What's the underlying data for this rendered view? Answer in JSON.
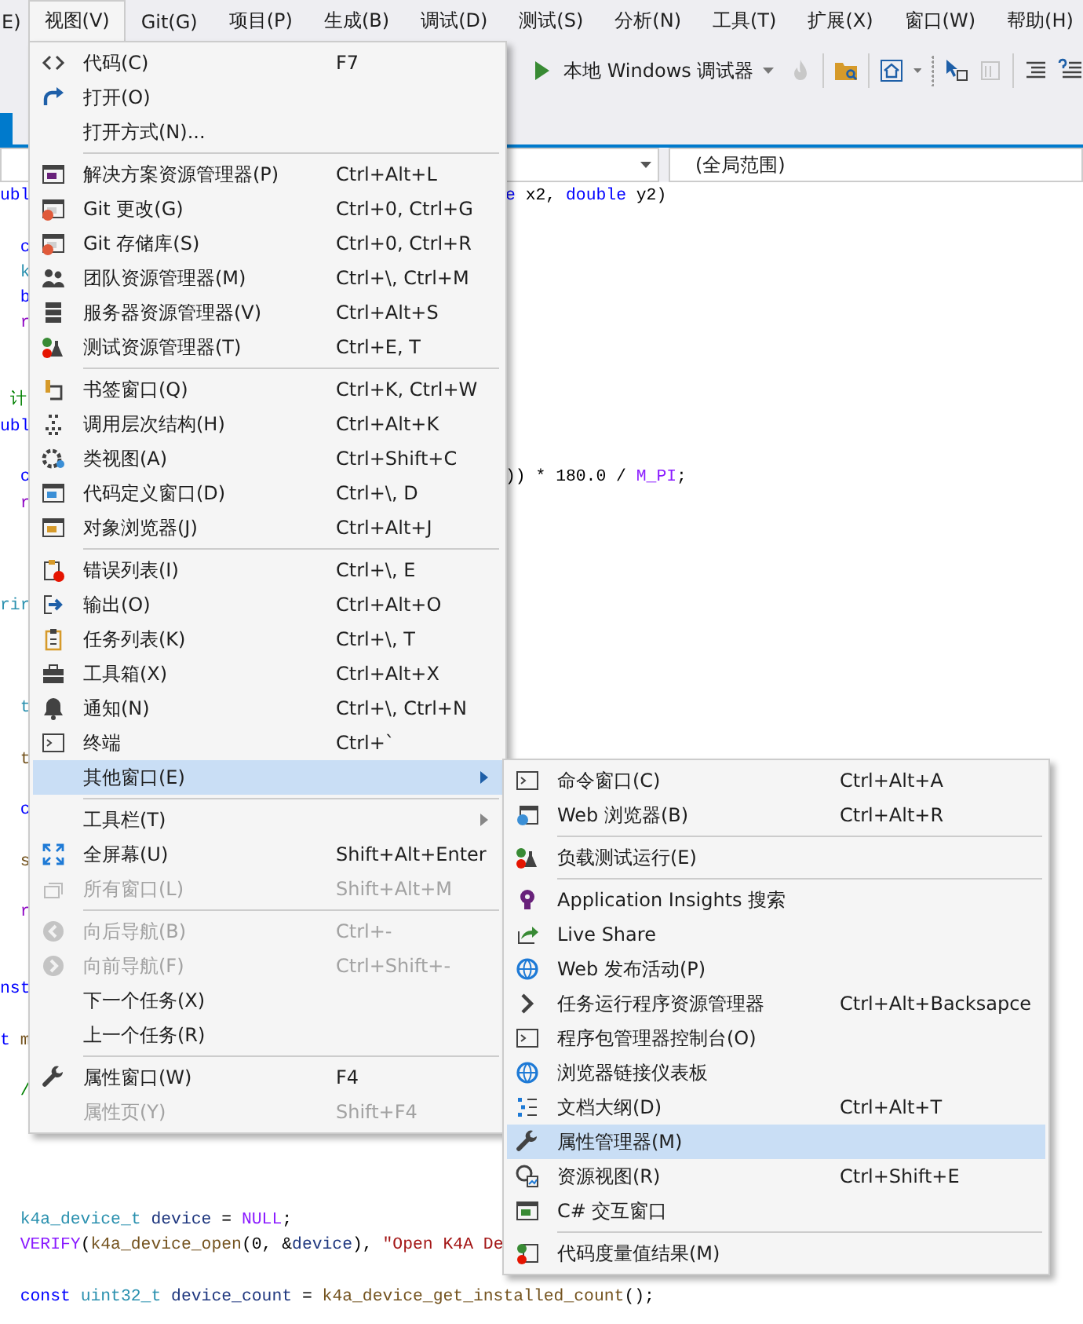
{
  "menu_bar": [
    {
      "label": "E)",
      "selected": false
    },
    {
      "label": "视图(V)",
      "selected": true
    },
    {
      "label": "Git(G)",
      "selected": false
    },
    {
      "label": "项目(P)",
      "selected": false
    },
    {
      "label": "生成(B)",
      "selected": false
    },
    {
      "label": "调试(D)",
      "selected": false
    },
    {
      "label": "测试(S)",
      "selected": false
    },
    {
      "label": "分析(N)",
      "selected": false
    },
    {
      "label": "工具(T)",
      "selected": false
    },
    {
      "label": "扩展(X)",
      "selected": false
    },
    {
      "label": "窗口(W)",
      "selected": false
    },
    {
      "label": "帮助(H)",
      "selected": false
    }
  ],
  "toolbar": {
    "debug_target": "本地 Windows 调试器"
  },
  "nav_bar": {
    "scope": "(全局范围)"
  },
  "code_lines": [
    {
      "tokens": [
        {
          "text": "ubl",
          "kind": "keyword"
        }
      ],
      "after_menu": [
        {
          "text": "e",
          "kind": "keyword"
        },
        {
          "text": " x2, ",
          "kind": "plain"
        },
        {
          "text": "double",
          "kind": "keyword"
        },
        {
          "text": " y2)",
          "kind": "plain"
        }
      ]
    },
    {
      "tokens": [
        {
          "text": "  c",
          "kind": "keyword"
        }
      ]
    },
    {
      "tokens": [
        {
          "text": "  k",
          "kind": "type"
        }
      ]
    },
    {
      "tokens": [
        {
          "text": "  b",
          "kind": "keyword"
        }
      ]
    },
    {
      "tokens": [
        {
          "text": "  r",
          "kind": "control"
        }
      ]
    },
    {
      "tokens": [
        {
          "text": " 计",
          "kind": "comment"
        }
      ]
    },
    {
      "tokens": [
        {
          "text": "ubl",
          "kind": "keyword"
        }
      ]
    },
    {
      "tokens": [
        {
          "text": "  c",
          "kind": "keyword"
        }
      ],
      "after_menu": [
        {
          "text": ")) * 180.0 / ",
          "kind": "plain"
        },
        {
          "text": "M_PI",
          "kind": "macro"
        },
        {
          "text": ";",
          "kind": "plain"
        }
      ]
    },
    {
      "tokens": [
        {
          "text": "  r",
          "kind": "control"
        }
      ]
    },
    {
      "tokens": [
        {
          "text": "rir",
          "kind": "type"
        }
      ]
    },
    {
      "tokens": [
        {
          "text": "  t",
          "kind": "type"
        }
      ]
    },
    {
      "tokens": [
        {
          "text": "  t",
          "kind": "function"
        }
      ]
    },
    {
      "tokens": [
        {
          "text": "  c",
          "kind": "keyword"
        }
      ]
    },
    {
      "tokens": [
        {
          "text": "  s",
          "kind": "function"
        }
      ]
    },
    {
      "tokens": [
        {
          "text": "  r",
          "kind": "control"
        }
      ]
    },
    {
      "tokens": [
        {
          "text": "nst",
          "kind": "keyword"
        }
      ]
    },
    {
      "tokens": [
        {
          "text": "t",
          "kind": "keyword"
        },
        {
          "text": " m",
          "kind": "function"
        }
      ]
    },
    {
      "tokens": [
        {
          "text": "  /",
          "kind": "comment"
        }
      ]
    },
    {
      "tokens": [
        {
          "text": "  k4a_device_t",
          "kind": "type"
        },
        {
          "text": " device",
          "kind": "variable"
        },
        {
          "text": " = ",
          "kind": "plain"
        },
        {
          "text": "NULL",
          "kind": "macro"
        },
        {
          "text": ";",
          "kind": "plain"
        }
      ]
    },
    {
      "tokens": [
        {
          "text": "  VERIFY",
          "kind": "macro"
        },
        {
          "text": "(",
          "kind": "plain"
        },
        {
          "text": "k4a_device_open",
          "kind": "function"
        },
        {
          "text": "(0, &",
          "kind": "plain"
        },
        {
          "text": "device",
          "kind": "variable"
        },
        {
          "text": "), ",
          "kind": "plain"
        },
        {
          "text": "\"Open K4A De",
          "kind": "string"
        }
      ]
    },
    {
      "tokens": [
        {
          "text": "  const",
          "kind": "keyword"
        },
        {
          "text": " uint32_t",
          "kind": "type"
        },
        {
          "text": " device_count",
          "kind": "variable"
        },
        {
          "text": " = ",
          "kind": "plain"
        },
        {
          "text": "k4a_device_get_installed_count",
          "kind": "function"
        },
        {
          "text": "();",
          "kind": "plain"
        }
      ]
    }
  ],
  "view_menu": {
    "groups": [
      {
        "items": [
          {
            "label": "代码(C)",
            "shortcut": "F7",
            "disabled": false,
            "selected": false,
            "has_submenu": false
          },
          {
            "label": "打开(O)",
            "disabled": false,
            "selected": false,
            "has_submenu": false
          },
          {
            "label": "打开方式(N)...",
            "disabled": false,
            "selected": false,
            "has_submenu": false
          }
        ]
      },
      {
        "items": [
          {
            "label": "解决方案资源管理器(P)",
            "shortcut": "Ctrl+Alt+L",
            "disabled": false,
            "selected": false,
            "has_submenu": false
          },
          {
            "label": "Git 更改(G)",
            "shortcut": "Ctrl+0, Ctrl+G",
            "disabled": false,
            "selected": false,
            "has_submenu": false
          },
          {
            "label": "Git 存储库(S)",
            "shortcut": "Ctrl+0, Ctrl+R",
            "disabled": false,
            "selected": false,
            "has_submenu": false
          },
          {
            "label": "团队资源管理器(M)",
            "shortcut": "Ctrl+\\, Ctrl+M",
            "disabled": false,
            "selected": false,
            "has_submenu": false
          },
          {
            "label": "服务器资源管理器(V)",
            "shortcut": "Ctrl+Alt+S",
            "disabled": false,
            "selected": false,
            "has_submenu": false
          },
          {
            "label": "测试资源管理器(T)",
            "shortcut": "Ctrl+E, T",
            "disabled": false,
            "selected": false,
            "has_submenu": false
          }
        ]
      },
      {
        "items": [
          {
            "label": "书签窗口(Q)",
            "shortcut": "Ctrl+K, Ctrl+W",
            "disabled": false,
            "selected": false,
            "has_submenu": false
          },
          {
            "label": "调用层次结构(H)",
            "shortcut": "Ctrl+Alt+K",
            "disabled": false,
            "selected": false,
            "has_submenu": false
          },
          {
            "label": "类视图(A)",
            "shortcut": "Ctrl+Shift+C",
            "disabled": false,
            "selected": false,
            "has_submenu": false
          },
          {
            "label": "代码定义窗口(D)",
            "shortcut": "Ctrl+\\, D",
            "disabled": false,
            "selected": false,
            "has_submenu": false
          },
          {
            "label": "对象浏览器(J)",
            "shortcut": "Ctrl+Alt+J",
            "disabled": false,
            "selected": false,
            "has_submenu": false
          }
        ]
      },
      {
        "items": [
          {
            "label": "错误列表(I)",
            "shortcut": "Ctrl+\\, E",
            "disabled": false,
            "selected": false,
            "has_submenu": false
          },
          {
            "label": "输出(O)",
            "shortcut": "Ctrl+Alt+O",
            "disabled": false,
            "selected": false,
            "has_submenu": false
          },
          {
            "label": "任务列表(K)",
            "shortcut": "Ctrl+\\, T",
            "disabled": false,
            "selected": false,
            "has_submenu": false
          },
          {
            "label": "工具箱(X)",
            "shortcut": "Ctrl+Alt+X",
            "disabled": false,
            "selected": false,
            "has_submenu": false
          },
          {
            "label": "通知(N)",
            "shortcut": "Ctrl+\\, Ctrl+N",
            "disabled": false,
            "selected": false,
            "has_submenu": false
          },
          {
            "label": "终端",
            "shortcut": "Ctrl+`",
            "disabled": false,
            "selected": false,
            "has_submenu": false
          },
          {
            "label": "其他窗口(E)",
            "disabled": false,
            "selected": true,
            "has_submenu": true
          }
        ]
      },
      {
        "items": [
          {
            "label": "工具栏(T)",
            "disabled": false,
            "selected": false,
            "has_submenu": true
          },
          {
            "label": "全屏幕(U)",
            "shortcut": "Shift+Alt+Enter",
            "disabled": false,
            "selected": false,
            "has_submenu": false
          },
          {
            "label": "所有窗口(L)",
            "shortcut": "Shift+Alt+M",
            "disabled": true,
            "selected": false,
            "has_submenu": false
          }
        ]
      },
      {
        "items": [
          {
            "label": "向后导航(B)",
            "shortcut": "Ctrl+-",
            "disabled": true,
            "selected": false,
            "has_submenu": false
          },
          {
            "label": "向前导航(F)",
            "shortcut": "Ctrl+Shift+-",
            "disabled": true,
            "selected": false,
            "has_submenu": false
          },
          {
            "label": "下一个任务(X)",
            "disabled": false,
            "selected": false,
            "has_submenu": false
          },
          {
            "label": "上一个任务(R)",
            "disabled": false,
            "selected": false,
            "has_submenu": false
          }
        ]
      },
      {
        "items": [
          {
            "label": "属性窗口(W)",
            "shortcut": "F4",
            "disabled": false,
            "selected": false,
            "has_submenu": false
          },
          {
            "label": "属性页(Y)",
            "shortcut": "Shift+F4",
            "disabled": true,
            "selected": false,
            "has_submenu": false
          }
        ]
      }
    ]
  },
  "other_windows_menu": {
    "groups": [
      {
        "items": [
          {
            "label": "命令窗口(C)",
            "shortcut": "Ctrl+Alt+A",
            "selected": false
          },
          {
            "label": "Web 浏览器(B)",
            "shortcut": "Ctrl+Alt+R",
            "selected": false
          }
        ]
      },
      {
        "items": [
          {
            "label": "负载测试运行(E)",
            "selected": false
          }
        ]
      },
      {
        "items": [
          {
            "label": "Application Insights 搜索",
            "selected": false
          },
          {
            "label": "Live Share",
            "selected": false
          },
          {
            "label": "Web 发布活动(P)",
            "selected": false
          },
          {
            "label": "任务运行程序资源管理器",
            "shortcut": "Ctrl+Alt+Backsapce",
            "selected": false
          },
          {
            "label": "程序包管理器控制台(O)",
            "selected": false
          },
          {
            "label": "浏览器链接仪表板",
            "selected": false
          },
          {
            "label": "文档大纲(D)",
            "shortcut": "Ctrl+Alt+T",
            "selected": false
          },
          {
            "label": "属性管理器(M)",
            "selected": true
          },
          {
            "label": "资源视图(R)",
            "shortcut": "Ctrl+Shift+E",
            "selected": false
          },
          {
            "label": "C# 交互窗口",
            "selected": false
          }
        ]
      },
      {
        "items": [
          {
            "label": "代码度量值结果(M)",
            "selected": false
          }
        ]
      }
    ]
  }
}
